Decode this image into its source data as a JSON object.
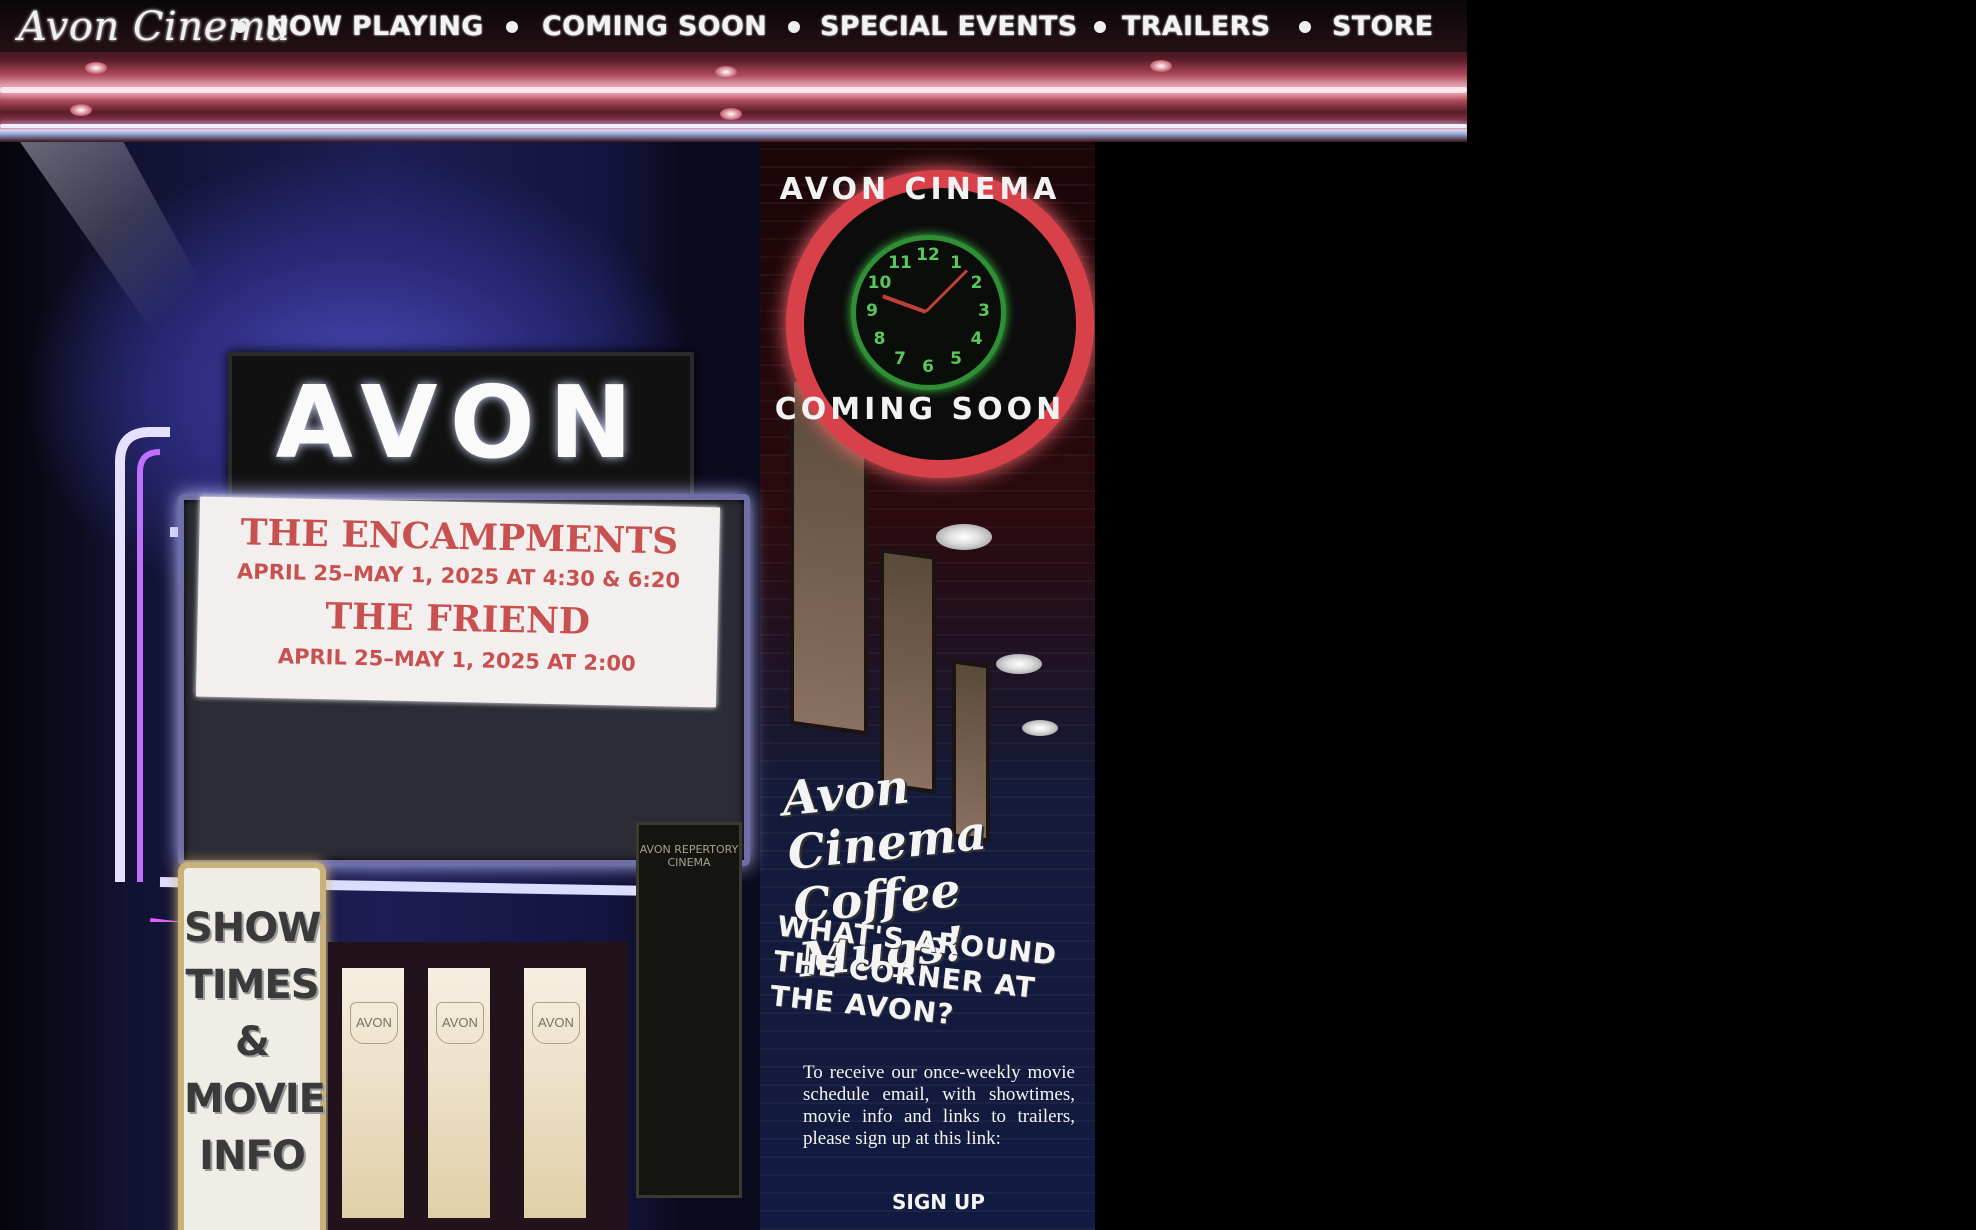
{
  "nav": {
    "logo": "Avon Cinema",
    "items": [
      "NOW PLAYING",
      "COMING SOON",
      "SPECIAL EVENTS",
      "TRAILERS",
      "STORE"
    ]
  },
  "marquee": {
    "sign": "AVON",
    "line1": "THE ENCAMPMENTS",
    "line2": "APRIL 25–MAY 1, 2025 AT 4:30 & 6:20",
    "line3": "THE FRIEND",
    "line4": "APRIL 25–MAY 1, 2025 AT 2:00"
  },
  "showtimes_sign": [
    "SHOW",
    "TIMES",
    "&",
    "MOVIE",
    "INFO"
  ],
  "door_logo": "AVON",
  "poster_case": "AVON REPERTORY CINEMA",
  "clock": {
    "top_text": "AVON CINEMA",
    "bottom_text": "COMING SOON",
    "numbers": [
      "12",
      "1",
      "2",
      "3",
      "4",
      "5",
      "6",
      "7",
      "8",
      "9",
      "10",
      "11"
    ]
  },
  "promo": {
    "mugs": "Avon Cinema Coffee Mugs!",
    "around": "WHAT'S AROUND THE CORNER AT THE AVON?",
    "signup_text": "To receive our once-weekly movie schedule email, with showtimes, movie info and links to trailers, please sign up at this link:",
    "signup_link": "SIGN UP"
  },
  "colors": {
    "neon_red": "#d9414a",
    "neon_green": "#3fbf45",
    "marquee_text": "#c8504e",
    "background": "#000000"
  }
}
